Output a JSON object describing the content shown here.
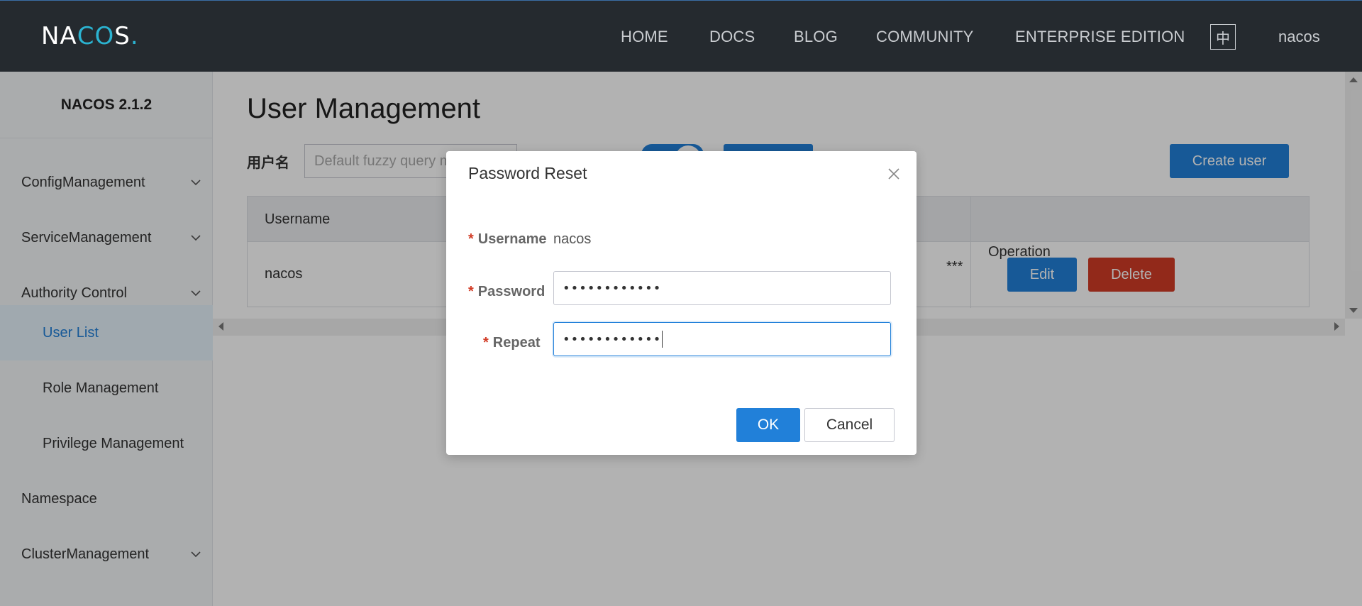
{
  "header": {
    "logo": "NACOS.",
    "nav": {
      "home": "HOME",
      "docs": "DOCS",
      "blog": "BLOG",
      "community": "COMMUNITY",
      "enterprise": "ENTERPRISE EDITION"
    },
    "language_toggle": "中",
    "user": "nacos"
  },
  "sidebar": {
    "version": "NACOS 2.1.2",
    "items": [
      {
        "label": "ConfigManagement",
        "expandable": true
      },
      {
        "label": "ServiceManagement",
        "expandable": true
      },
      {
        "label": "Authority Control",
        "expandable": true
      },
      {
        "label": "User List",
        "active": true
      },
      {
        "label": "Role Management"
      },
      {
        "label": "Privilege Management"
      },
      {
        "label": "Namespace"
      },
      {
        "label": "ClusterManagement",
        "expandable": true
      }
    ]
  },
  "main": {
    "title": "User Management",
    "filter": {
      "label": "用户名",
      "placeholder": "Default fuzzy query m"
    },
    "create_button": "Create user",
    "table": {
      "columns": [
        "Username",
        "Operation"
      ],
      "rows": [
        {
          "username": "nacos",
          "password_masked": "***",
          "edit": "Edit",
          "delete": "Delete"
        }
      ]
    }
  },
  "dialog": {
    "title": "Password Reset",
    "fields": {
      "username_label": "Username",
      "username_value": "nacos",
      "password_label": "Password",
      "password_value": "••••••••••••",
      "repeat_label": "Repeat",
      "repeat_value": "••••••••••••"
    },
    "ok": "OK",
    "cancel": "Cancel",
    "required_mark": "*"
  },
  "colors": {
    "topbar": "#252a2f",
    "primary": "#2180d9",
    "danger": "#d23c26",
    "sidebar_bg": "#f4f6f8"
  }
}
